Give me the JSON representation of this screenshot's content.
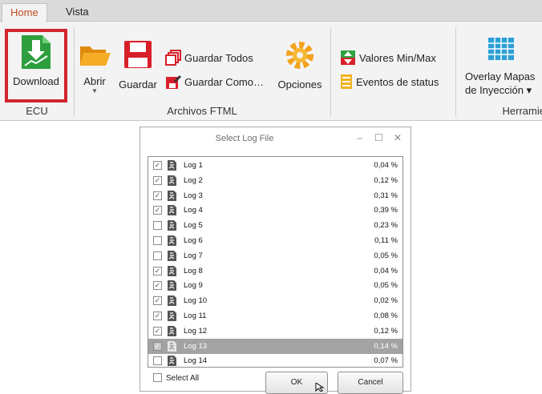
{
  "ribbon": {
    "tabs": [
      {
        "label": "Home"
      },
      {
        "label": "Vista"
      }
    ],
    "groups": {
      "ecu": {
        "label": "ECU",
        "download_label": "Download"
      },
      "archivos": {
        "label": "Archivos FTML",
        "abrir_label": "Abrir",
        "guardar_label": "Guardar",
        "guardar_todos_label": "Guardar Todos",
        "guardar_como_label": "Guardar Como…",
        "opciones_label": "Opciones"
      },
      "herramientas": {
        "label": "Herramie",
        "valores_label": "Valores Min/Max",
        "eventos_label": "Eventos de status",
        "overlay_line1": "Overlay Mapas",
        "overlay_line2": "de Inyección ▾"
      }
    },
    "colors": {
      "active_tab": "#c24b1e",
      "highlight": "#d1262c"
    }
  },
  "dialog": {
    "title": "Select Log File",
    "controls": {
      "minimize": "–",
      "maximize": "☐",
      "close": "✕"
    },
    "logs": [
      {
        "name": "Log 1",
        "value": "0,04 %",
        "checked": true
      },
      {
        "name": "Log 2",
        "value": "0,12 %",
        "checked": true
      },
      {
        "name": "Log 3",
        "value": "0,31 %",
        "checked": true
      },
      {
        "name": "Log 4",
        "value": "0,39 %",
        "checked": true
      },
      {
        "name": "Log 5",
        "value": "0,23 %",
        "checked": false
      },
      {
        "name": "Log 6",
        "value": "0,11 %",
        "checked": false
      },
      {
        "name": "Log 7",
        "value": "0,05 %",
        "checked": false
      },
      {
        "name": "Log 8",
        "value": "0,04 %",
        "checked": true
      },
      {
        "name": "Log 9",
        "value": "0,05 %",
        "checked": true
      },
      {
        "name": "Log 10",
        "value": "0,02 %",
        "checked": true
      },
      {
        "name": "Log 11",
        "value": "0,08 %",
        "checked": true
      },
      {
        "name": "Log 12",
        "value": "0,12 %",
        "checked": true
      },
      {
        "name": "Log 13",
        "value": "0,14 %",
        "checked": true,
        "selected": true
      },
      {
        "name": "Log 14",
        "value": "0,07 %",
        "checked": false
      }
    ],
    "select_all_label": "Select All",
    "ok_label": "OK",
    "cancel_label": "Cancel"
  }
}
